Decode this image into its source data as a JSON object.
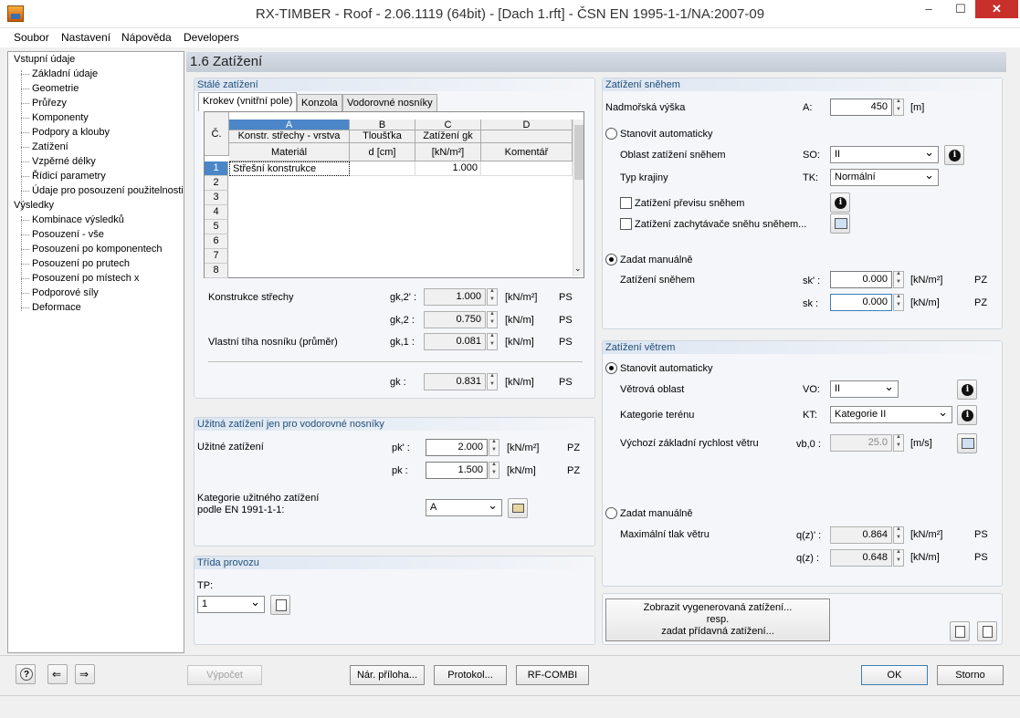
{
  "window": {
    "title": "RX-TIMBER - Roof - 2.06.1119 (64bit) - [Dach 1.rft] - ČSN EN 1995-1-1/NA:2007-09",
    "min": "–",
    "max": "☐",
    "close": "✕"
  },
  "menu": [
    "Soubor",
    "Nastavení",
    "Nápověda",
    "Developers"
  ],
  "tree": {
    "input": "Vstupní údaje",
    "input_items": [
      "Základní údaje",
      "Geometrie",
      "Průřezy",
      "Komponenty",
      "Podpory a klouby",
      "Zatížení",
      "Vzpěrné délky",
      "Řídicí parametry",
      "Údaje pro posouzení použitelnosti"
    ],
    "results": "Výsledky",
    "results_items": [
      "Kombinace výsledků",
      "Posouzení - vše",
      "Posouzení po komponentech",
      "Posouzení po prutech",
      "Posouzení po místech x",
      "Podporové síly",
      "Deformace"
    ]
  },
  "header": "1.6 Zatížení",
  "perm": {
    "title": "Stálé zatížení",
    "tabs": [
      "Krokev (vnitřní pole)",
      "Konzola",
      "Vodorovné nosníky"
    ],
    "grid": {
      "col_letters": [
        "A",
        "B",
        "C",
        "D"
      ],
      "corner": "Č.",
      "h1": [
        "Konstr. střechy - vrstva",
        "Tloušťka",
        "Zatížení gk",
        ""
      ],
      "h2": [
        "Materiál",
        "d [cm]",
        "[kN/m²]",
        "Komentář"
      ],
      "rows": [
        "1",
        "2",
        "3",
        "4",
        "5",
        "6",
        "7",
        "8"
      ],
      "r1": {
        "a": "Střešní konstrukce",
        "c": "1.000"
      }
    },
    "roof_label": "Konstrukce střechy",
    "own_label": "Vlastní tíha nosníku (průměr)",
    "rows": [
      {
        "sym": "gk,2' :",
        "val": "1.000",
        "unit": "[kN/m²]",
        "tag": "PS"
      },
      {
        "sym": "gk,2 :",
        "val": "0.750",
        "unit": "[kN/m]",
        "tag": "PS"
      },
      {
        "sym": "gk,1 :",
        "val": "0.081",
        "unit": "[kN/m]",
        "tag": "PS"
      },
      {
        "sym": "gk :",
        "val": "0.831",
        "unit": "[kN/m]",
        "tag": "PS"
      }
    ]
  },
  "live": {
    "title": "Užitná zatížení jen pro vodorovné nosníky",
    "label": "Užitné zatížení",
    "rows": [
      {
        "sym": "pk' :",
        "val": "2.000",
        "unit": "[kN/m²]",
        "tag": "PZ"
      },
      {
        "sym": "pk :",
        "val": "1.500",
        "unit": "[kN/m]",
        "tag": "PZ"
      }
    ],
    "cat_label1": "Kategorie užitného zatížení",
    "cat_label2": "podle EN 1991-1-1:",
    "cat_value": "A"
  },
  "service": {
    "title": "Třída provozu",
    "label": "TP:",
    "value": "1"
  },
  "snow": {
    "title": "Zatížení sněhem",
    "alt_label": "Nadmořská výška",
    "alt_sym": "A:",
    "alt_val": "450",
    "alt_unit": "[m]",
    "auto": "Stanovit automaticky",
    "zone_label": "Oblast zatížení sněhem",
    "zone_sym": "SO:",
    "zone_val": "II",
    "terrain_label": "Typ krajiny",
    "terrain_sym": "TK:",
    "terrain_val": "Normální",
    "drift": "Zatížení převisu sněhem",
    "guard": "Zatížení zachytávače sněhu sněhem...",
    "manual": "Zadat manuálně",
    "load_label": "Zatížení sněhem",
    "rows": [
      {
        "sym": "sk' :",
        "val": "0.000",
        "unit": "[kN/m²]",
        "tag": "PZ"
      },
      {
        "sym": "sk :",
        "val": "0.000",
        "unit": "[kN/m]",
        "tag": "PZ"
      }
    ]
  },
  "wind": {
    "title": "Zatížení větrem",
    "auto": "Stanovit automaticky",
    "zone_label": "Větrová oblast",
    "zone_sym": "VO:",
    "zone_val": "II",
    "cat_label": "Kategorie terénu",
    "cat_sym": "KT:",
    "cat_val": "Kategorie II",
    "speed_label": "Výchozí základní rychlost větru",
    "speed_sym": "vb,0 :",
    "speed_val": "25.0",
    "speed_unit": "[m/s]",
    "manual": "Zadat manuálně",
    "press_label": "Maximální tlak větru",
    "rows": [
      {
        "sym": "q(z)' :",
        "val": "0.864",
        "unit": "[kN/m²]",
        "tag": "PS"
      },
      {
        "sym": "q(z) :",
        "val": "0.648",
        "unit": "[kN/m]",
        "tag": "PS"
      }
    ]
  },
  "gen_button": [
    "Zobrazit vygenerovaná zatížení...",
    "resp.",
    "zadat přídavná zatížení..."
  ],
  "bottom": {
    "calc": "Výpočet",
    "annex": "Nár. příloha...",
    "protocol": "Protokol...",
    "rfcombi": "RF-COMBI",
    "ok": "OK",
    "cancel": "Storno"
  }
}
